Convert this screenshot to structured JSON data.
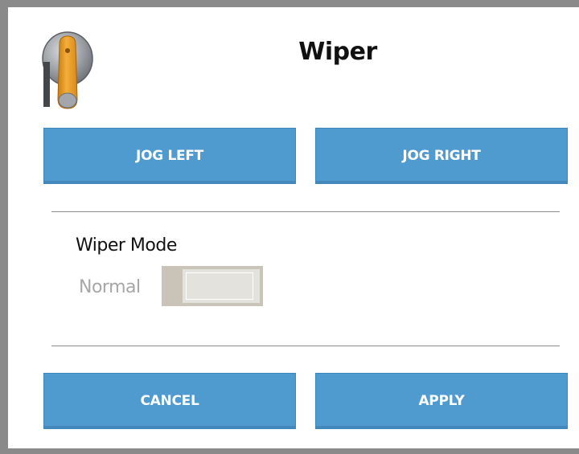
{
  "dialog": {
    "title": "Wiper",
    "icon": "wiper-icon"
  },
  "jog": {
    "left_label": "JOG LEFT",
    "right_label": "JOG RIGHT"
  },
  "wiper_mode": {
    "label": "Wiper Mode",
    "value": "Normal",
    "toggle_on": false
  },
  "footer": {
    "cancel_label": "CANCEL",
    "apply_label": "APPLY"
  },
  "colors": {
    "button_blue": "#4f9bd0",
    "frame_gray": "#8a8a8a",
    "icon_orange": "#f0a531",
    "toggle_tan": "#c9c4b7"
  }
}
